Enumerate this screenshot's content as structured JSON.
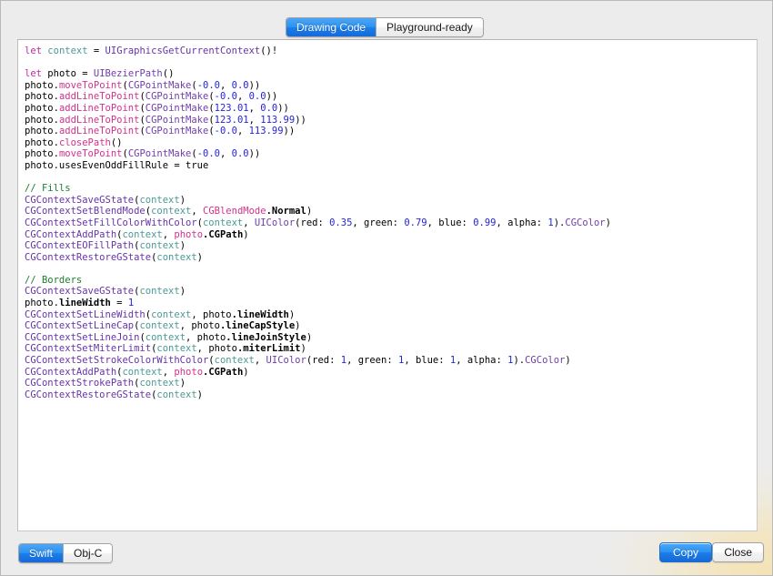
{
  "window": {
    "background_color": "#ececec",
    "corner_wash_color": "#f5e2b2"
  },
  "tabs": {
    "items": [
      {
        "label": "Drawing Code",
        "selected": true
      },
      {
        "label": "Playground-ready",
        "selected": false
      }
    ]
  },
  "language_switch": {
    "items": [
      {
        "label": "Swift",
        "selected": true
      },
      {
        "label": "Obj-C",
        "selected": false
      }
    ]
  },
  "actions": {
    "copy_label": "Copy",
    "close_label": "Close"
  },
  "code": {
    "language": "Swift",
    "accent_color": "#1b7ee9",
    "lines": [
      "let context = UIGraphicsGetCurrentContext()!",
      "",
      "let photo = UIBezierPath()",
      "photo.moveToPoint(CGPointMake(-0.0, 0.0))",
      "photo.addLineToPoint(CGPointMake(-0.0, 0.0))",
      "photo.addLineToPoint(CGPointMake(123.01, 0.0))",
      "photo.addLineToPoint(CGPointMake(123.01, 113.99))",
      "photo.addLineToPoint(CGPointMake(-0.0, 113.99))",
      "photo.closePath()",
      "photo.moveToPoint(CGPointMake(-0.0, 0.0))",
      "photo.usesEvenOddFillRule = true",
      "",
      "// Fills",
      "CGContextSaveGState(context)",
      "CGContextSetBlendMode(context, CGBlendMode.Normal)",
      "CGContextSetFillColorWithColor(context, UIColor(red: 0.35, green: 0.79, blue: 0.99, alpha: 1).CGColor)",
      "CGContextAddPath(context, photo.CGPath)",
      "CGContextEOFillPath(context)",
      "CGContextRestoreGState(context)",
      "",
      "// Borders",
      "CGContextSaveGState(context)",
      "photo.lineWidth = 1",
      "CGContextSetLineWidth(context, photo.lineWidth)",
      "CGContextSetLineCap(context, photo.lineCapStyle)",
      "CGContextSetLineJoin(context, photo.lineJoinStyle)",
      "CGContextSetMiterLimit(context, photo.miterLimit)",
      "CGContextSetStrokeColorWithColor(context, UIColor(red: 1, green: 1, blue: 1, alpha: 1).CGColor)",
      "CGContextAddPath(context, photo.CGPath)",
      "CGContextStrokePath(context)",
      "CGContextRestoreGState(context)"
    ],
    "fill_color": {
      "red": 0.35,
      "green": 0.79,
      "blue": 0.99,
      "alpha": 1
    },
    "stroke_color": {
      "red": 1,
      "green": 1,
      "blue": 1,
      "alpha": 1
    },
    "path_points": [
      [
        -0.0,
        0.0
      ],
      [
        -0.0,
        0.0
      ],
      [
        123.01,
        0.0
      ],
      [
        123.01,
        113.99
      ],
      [
        -0.0,
        113.99
      ]
    ],
    "line_width": 1,
    "blend_mode": "CGBlendMode.Normal",
    "uses_even_odd_fill_rule": true,
    "path_variable": "photo",
    "context_variable": "context"
  }
}
